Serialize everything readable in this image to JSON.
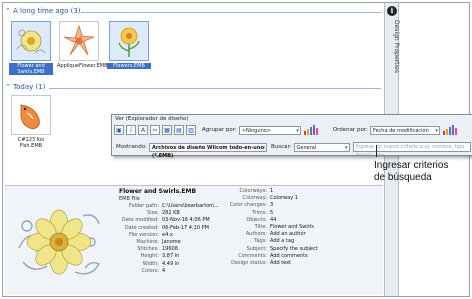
{
  "side_panel": {
    "label": "Design Properties"
  },
  "groups": [
    {
      "title": "A long time ago (3)",
      "items": [
        {
          "name": "Flower and Swirls.EMB",
          "selected": true
        },
        {
          "name": "AppliqueFlower.EMB",
          "selected": false
        },
        {
          "name": "Flowers.EMB",
          "selected": true
        }
      ]
    },
    {
      "title": "Today (1)",
      "items": [
        {
          "name": "C#123 Koi Fish.EMB",
          "selected": false
        }
      ]
    }
  ],
  "toolbar": {
    "title": "Ver (Explorador de diseño)",
    "group_by_label": "Agrupar por:",
    "group_by_value": "<Ninguno>",
    "sort_by_label": "Ordenar por:",
    "sort_by_value": "Fecha de modificación",
    "show_label": "Mostrando:",
    "show_value": "Archivos de diseño Wilcom todo-en-uno (*.EMB)",
    "search_label": "Buscar:",
    "search_scope": "General",
    "search_placeholder": "Ingrese un nuevo criterio p.ej. nombre, tipo de tela, etc",
    "bar_colors": [
      "#e0392b",
      "#f2a20c",
      "#3a7bd5",
      "#8b4fc9",
      "#d94c9b"
    ]
  },
  "callout": {
    "line1": "Ingresar criterios",
    "line2": "de búsqueda"
  },
  "details": {
    "title": "Flower and Swirls.EMB",
    "subtitle": "EMB File",
    "left": [
      {
        "k": "Folder path:",
        "v": "C:\\Users\\bearbarton\\..."
      },
      {
        "k": "Size:",
        "v": "282 KB"
      },
      {
        "k": "Date modified:",
        "v": "03-Nov-16 4:06 PM"
      },
      {
        "k": "Date created:",
        "v": "06-Feb-17 4:10 PM"
      },
      {
        "k": "File version:",
        "v": "e4.x"
      },
      {
        "k": "Machine:",
        "v": "Janome"
      },
      {
        "k": "Stitches:",
        "v": "19608"
      },
      {
        "k": "Height:",
        "v": "3.87 in"
      },
      {
        "k": "Width:",
        "v": "4.49 in"
      },
      {
        "k": "Colors:",
        "v": "4"
      }
    ],
    "right": [
      {
        "k": "Colorways:",
        "v": "1"
      },
      {
        "k": "Colorway:",
        "v": "Colorway 1"
      },
      {
        "k": "Color changes:",
        "v": "3"
      },
      {
        "k": "Trims:",
        "v": "5"
      },
      {
        "k": "Objects:",
        "v": "44"
      },
      {
        "k": "Title:",
        "v": "Flower and Swirls"
      },
      {
        "k": "Authors:",
        "v": "Add an author"
      },
      {
        "k": "Tags:",
        "v": "Add a tag"
      },
      {
        "k": "Subject:",
        "v": "Specify the subject"
      },
      {
        "k": "Comments:",
        "v": "Add comments"
      },
      {
        "k": "Design status:",
        "v": "Add text"
      }
    ]
  }
}
